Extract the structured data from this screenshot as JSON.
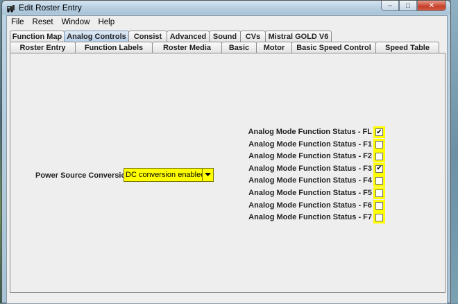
{
  "window": {
    "title": "Edit Roster Entry",
    "controls": {
      "minimize": "–",
      "maximize": "□",
      "close": "✕"
    }
  },
  "menu": [
    "File",
    "Reset",
    "Window",
    "Help"
  ],
  "tabs": {
    "row1": [
      {
        "label": "Function Map",
        "active": false
      },
      {
        "label": "Analog Controls",
        "active": true
      },
      {
        "label": "Consist",
        "active": false
      },
      {
        "label": "Advanced",
        "active": false
      },
      {
        "label": "Sound",
        "active": false
      },
      {
        "label": "CVs",
        "active": false
      },
      {
        "label": "Mistral GOLD V6",
        "active": false
      }
    ],
    "row2": [
      {
        "label": "Roster Entry"
      },
      {
        "label": "Function Labels"
      },
      {
        "label": "Roster Media"
      },
      {
        "label": "Basic"
      },
      {
        "label": "Motor"
      },
      {
        "label": "Basic Speed Control"
      },
      {
        "label": "Speed Table"
      }
    ]
  },
  "power_source": {
    "label": "Power Source Conversion",
    "value": "DC conversion enabled"
  },
  "analog_functions": [
    {
      "label": "Analog Mode Function Status - FL",
      "checked": true
    },
    {
      "label": "Analog Mode Function Status - F1",
      "checked": false
    },
    {
      "label": "Analog Mode Function Status - F2",
      "checked": false
    },
    {
      "label": "Analog Mode Function Status - F3",
      "checked": true
    },
    {
      "label": "Analog Mode Function Status - F4",
      "checked": false
    },
    {
      "label": "Analog Mode Function Status - F5",
      "checked": false
    },
    {
      "label": "Analog Mode Function Status - F6",
      "checked": false
    },
    {
      "label": "Analog Mode Function Status - F7",
      "checked": false
    }
  ],
  "colors": {
    "highlight": "#ffff00",
    "active_tab": "#b8cfe8",
    "panel": "#eeeeee"
  }
}
